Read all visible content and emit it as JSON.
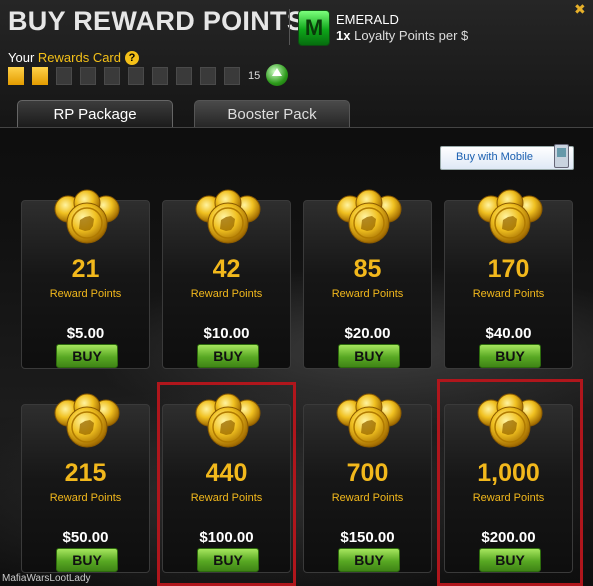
{
  "header": {
    "title": "BUY REWARD POINTS",
    "tier_badge": "M",
    "tier_name": "EMERALD",
    "tier_multiplier": "1x",
    "tier_desc": "Loyalty Points per $",
    "close_label": "✖"
  },
  "rewards_card": {
    "label_prefix": "Your",
    "label_highlight": "Rewards Card",
    "help": "?",
    "filled_segments": 2,
    "total_segments": 10,
    "count": "15"
  },
  "tabs": [
    {
      "label": "RP Package",
      "active": true
    },
    {
      "label": "Booster Pack",
      "active": false
    }
  ],
  "mobile_button": "Buy with Mobile",
  "packages": [
    {
      "points": "21",
      "label": "Reward Points",
      "price": "$5.00",
      "buy": "BUY"
    },
    {
      "points": "42",
      "label": "Reward Points",
      "price": "$10.00",
      "buy": "BUY"
    },
    {
      "points": "85",
      "label": "Reward Points",
      "price": "$20.00",
      "buy": "BUY"
    },
    {
      "points": "170",
      "label": "Reward Points",
      "price": "$40.00",
      "buy": "BUY"
    },
    {
      "points": "215",
      "label": "Reward Points",
      "price": "$50.00",
      "buy": "BUY"
    },
    {
      "points": "440",
      "label": "Reward Points",
      "price": "$100.00",
      "buy": "BUY"
    },
    {
      "points": "700",
      "label": "Reward Points",
      "price": "$150.00",
      "buy": "BUY"
    },
    {
      "points": "1,000",
      "label": "Reward Points",
      "price": "$200.00",
      "buy": "BUY"
    }
  ],
  "highlight_color": "#b0161c",
  "watermark": "MafiaWarsLootLady"
}
